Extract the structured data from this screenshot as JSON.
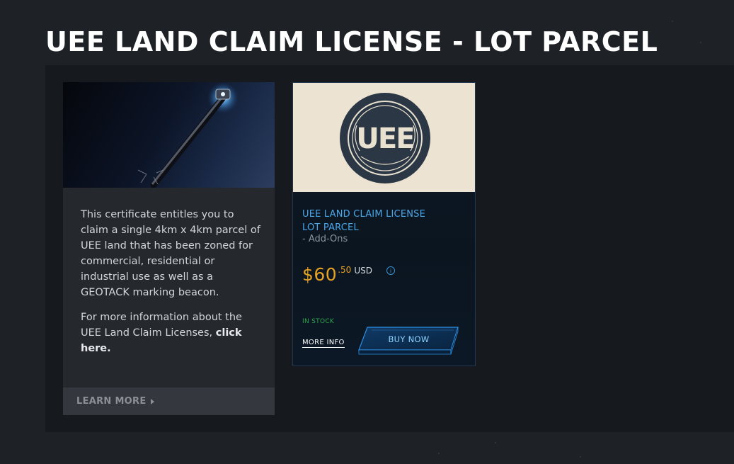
{
  "page": {
    "title": "UEE LAND CLAIM LICENSE - LOT PARCEL"
  },
  "info_card": {
    "paragraph1": "This certificate entitles you to claim a single 4km x 4km parcel of UEE land that has been zoned for commercial, residential or industrial use as well as a GEOTACK marking beacon.",
    "paragraph2_prefix": "For more information about the UEE Land Claim Licenses, ",
    "paragraph2_link": "click here.",
    "learn_more_label": "LEARN MORE",
    "image_icon": "geotack-beacon-image"
  },
  "product": {
    "logo_text": "UEE",
    "name_line1": "UEE LAND CLAIM LICENSE",
    "name_line2": "LOT PARCEL",
    "category": "- Add-Ons",
    "price_main": "$60",
    "price_cents": ".50",
    "currency": "USD",
    "info_icon_glyph": "i",
    "stock_status": "IN STOCK",
    "more_info_label": "MORE INFO",
    "buy_now_label": "BUY NOW"
  },
  "colors": {
    "accent_blue": "#4aa7e8",
    "price_gold": "#e6a322",
    "stock_green": "#2ea54b"
  }
}
